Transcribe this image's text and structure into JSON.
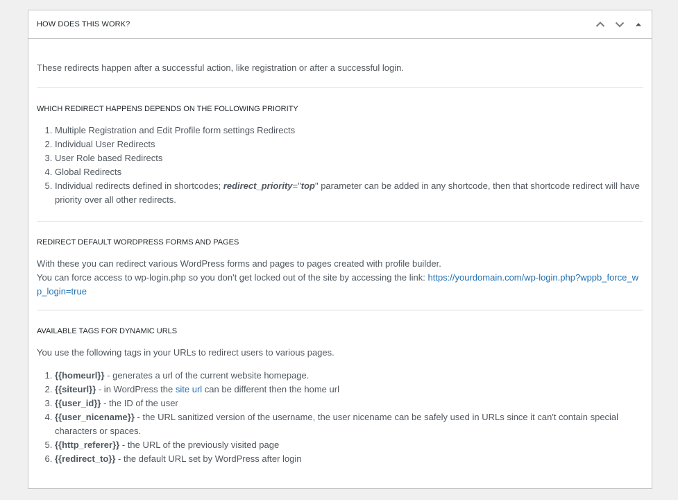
{
  "header": {
    "title": "HOW DOES THIS WORK?",
    "move_up_icon": "chevron-up-icon",
    "move_down_icon": "chevron-down-icon",
    "toggle_icon": "triangle-up-icon"
  },
  "intro": {
    "text": "These redirects happen after a successful action, like registration or after a successful login."
  },
  "priority": {
    "heading": "WHICH REDIRECT HAPPENS DEPENDS ON THE FOLLOWING PRIORITY",
    "items": [
      "Multiple Registration and Edit Profile form settings Redirects",
      "Individual User Redirects",
      "User Role based Redirects",
      "Global Redirects"
    ],
    "item5_prefix": "Individual redirects defined in shortcodes; ",
    "item5_param": "redirect_priority",
    "item5_eq": "=\"",
    "item5_value": "top",
    "item5_close": "\"",
    "item5_suffix": " parameter can be added in any shortcode, then that shortcode redirect will have priority over all other redirects."
  },
  "default_forms": {
    "heading": "REDIRECT DEFAULT WORDPRESS FORMS AND PAGES",
    "line1": "With these you can redirect various WordPress forms and pages to pages created with profile builder.",
    "line2_prefix": "You can force access to wp-login.php so you don't get locked out of the site by accessing the link: ",
    "link": "https://yourdomain.com/wp-login.php?wppb_force_wp_login=true"
  },
  "tags": {
    "heading": "AVAILABLE TAGS FOR DYNAMIC URLS",
    "intro": "You use the following tags in your URLs to redirect users to various pages.",
    "items": [
      {
        "tag": "{{homeurl}}",
        "desc": " - generates a url of the current website homepage."
      },
      {
        "tag": "{{siteurl}}",
        "desc_before": " - in WordPress the ",
        "link": "site url",
        "desc_after": " can be different then the home url"
      },
      {
        "tag": "{{user_id}}",
        "desc": " - the ID of the user"
      },
      {
        "tag": "{{user_nicename}}",
        "desc": " - the URL sanitized version of the username, the user nicename can be safely used in URLs since it can't contain special characters or spaces."
      },
      {
        "tag": "{{http_referer}}",
        "desc": " - the URL of the previously visited page"
      },
      {
        "tag": "{{redirect_to}}",
        "desc": " - the default URL set by WordPress after login"
      }
    ]
  }
}
